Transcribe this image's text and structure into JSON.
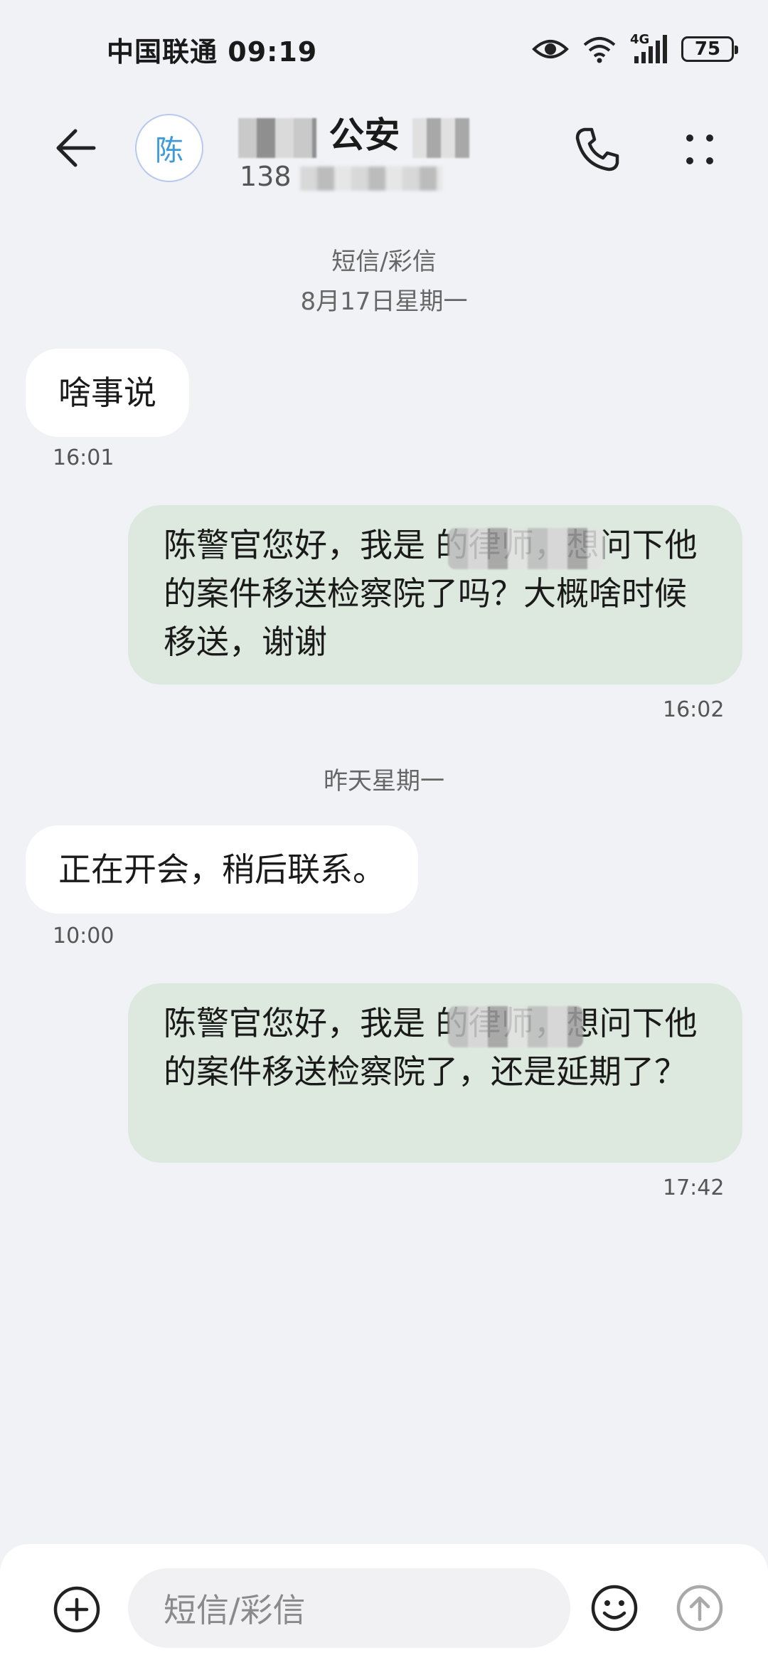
{
  "status_bar": {
    "carrier": "中国联通",
    "time": "09:19",
    "network": "4G",
    "battery": "75"
  },
  "header": {
    "avatar_initial": "陈",
    "contact_name": "公安",
    "contact_number_prefix": "138"
  },
  "thread": {
    "channel_label": "短信/彩信",
    "date_1": "8月17日星期一",
    "date_2": "昨天星期一",
    "messages": [
      {
        "direction": "incoming",
        "text": "啥事说",
        "time": "16:01"
      },
      {
        "direction": "outgoing",
        "text": "陈警官您好，我是        的律师，想问下他的案件移送检察院了吗？大概啥时候移送，谢谢",
        "time": "16:02"
      },
      {
        "direction": "incoming",
        "text": "正在开会，稍后联系。",
        "time": "10:00"
      },
      {
        "direction": "outgoing",
        "text": "陈警官您好，我是        的律师，想问下他的案件移送检察院了，还是延期了？",
        "time": "17:42"
      }
    ]
  },
  "compose": {
    "placeholder": "短信/彩信"
  },
  "icons": {
    "back": "arrow-left-icon",
    "call": "phone-icon",
    "more": "more-dots-icon",
    "add": "plus-circle-icon",
    "emoji": "emoji-icon",
    "send": "send-arrow-icon",
    "eye": "eye-icon",
    "wifi": "wifi-icon",
    "signal": "signal-icon"
  },
  "colors": {
    "background": "#f1f2f6",
    "incoming_bubble": "#ffffff",
    "outgoing_bubble": "#dde9df",
    "avatar_text": "#3e9bd8"
  }
}
